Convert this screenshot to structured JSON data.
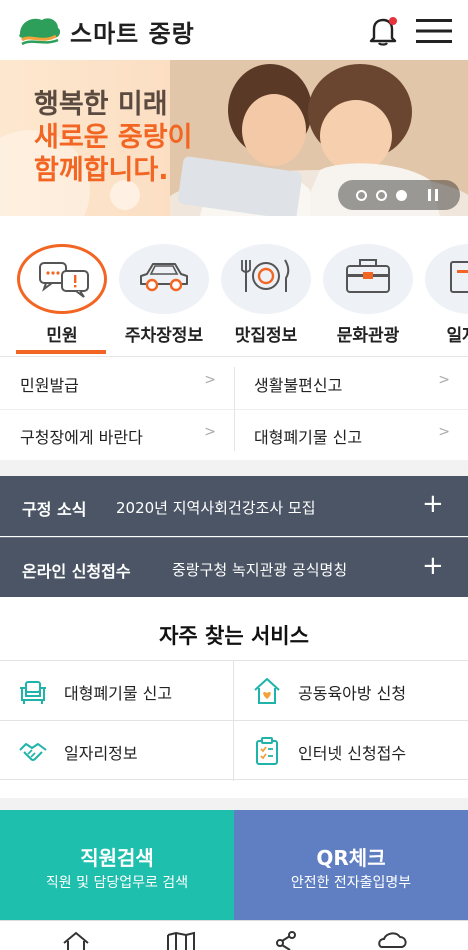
{
  "header": {
    "title": "스마트 중랑",
    "brand_color": "#2e9e5b"
  },
  "banner": {
    "line1": "행복한 미래",
    "line2": "새로운 중랑이",
    "line3": "함께합니다.",
    "slides_total": 3,
    "slide_active": 3
  },
  "categories": [
    {
      "label": "민원",
      "icon": "speech-bubbles-icon",
      "active": true
    },
    {
      "label": "주차장정보",
      "icon": "car-icon"
    },
    {
      "label": "맛집정보",
      "icon": "plate-fork-knife-icon"
    },
    {
      "label": "문화관광",
      "icon": "suitcase-icon"
    },
    {
      "label": "일자리",
      "icon": "jobs-icon"
    }
  ],
  "quick_links": [
    {
      "label": "민원발급",
      "chevron": ">"
    },
    {
      "label": "생활불편신고",
      "chevron": ">"
    },
    {
      "label": "구청장에게 바란다",
      "chevron": ">"
    },
    {
      "label": "대형폐기물 신고",
      "chevron": ">"
    }
  ],
  "news": [
    {
      "key": "구정 소식",
      "value": "2020년 지역사회건강조사 모집",
      "action": "+"
    },
    {
      "key": "온라인 신청접수",
      "value": "중랑구청 녹지관광 공식명칭",
      "action": "+"
    }
  ],
  "services": {
    "title": "자주 찾는 서비스",
    "items": [
      {
        "label": "대형폐기물 신고",
        "icon": "sofa-icon"
      },
      {
        "label": "공동육아방 신청",
        "icon": "house-heart-icon"
      },
      {
        "label": "일자리정보",
        "icon": "handshake-icon"
      },
      {
        "label": "인터넷 신청접수",
        "icon": "clipboard-icon"
      }
    ],
    "icon_color": "#1fb3a9"
  },
  "promos": [
    {
      "title": "직원검색",
      "subtitle": "직원 및 담당업무로 검색",
      "color": "#1fbfae"
    },
    {
      "title": "QR체크",
      "subtitle": "안전한 전자출입명부",
      "color": "#5f7fc2"
    }
  ],
  "bottom_nav": [
    "home-icon",
    "map-icon",
    "share-icon",
    "cloud-icon"
  ],
  "colors": {
    "accent": "#f26522",
    "news_bg": "#4b5565"
  }
}
